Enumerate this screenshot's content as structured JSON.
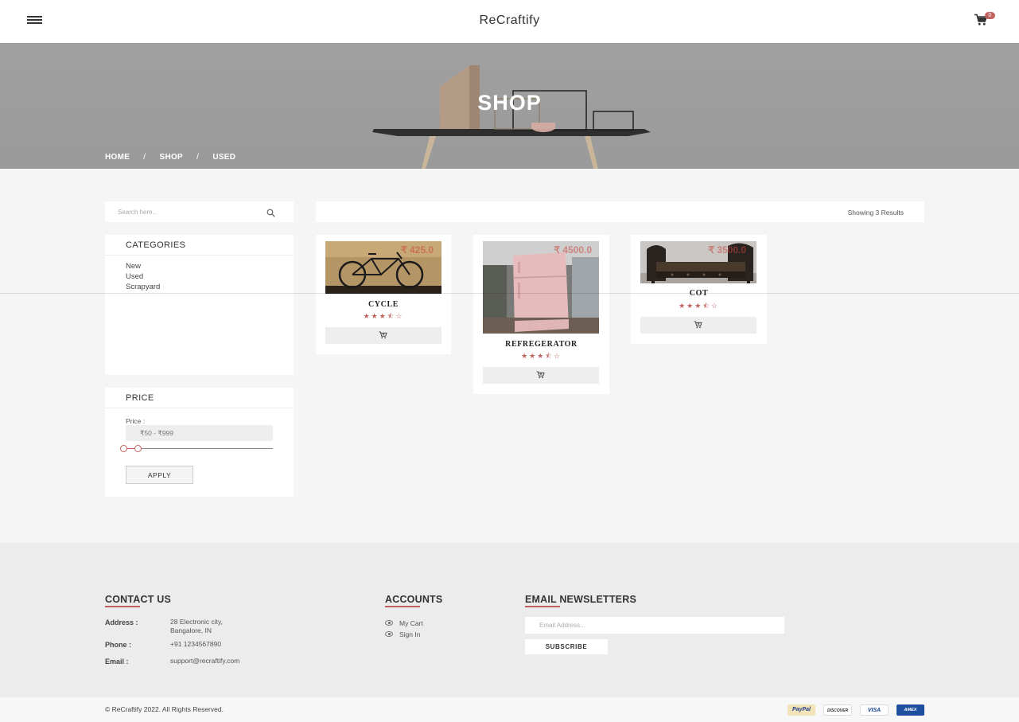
{
  "header": {
    "brand": "ReCraftify",
    "cart_count": "0"
  },
  "hero": {
    "title": "SHOP",
    "breadcrumb": [
      "HOME",
      "SHOP",
      "USED"
    ],
    "separator": "/"
  },
  "search": {
    "placeholder": "Search here..."
  },
  "categories": {
    "title": "CATEGORIES",
    "items": [
      "New",
      "Used",
      "Scrapyard"
    ]
  },
  "price_filter": {
    "title": "PRICE",
    "label": "Price :",
    "range_text": "₹50 - ₹999",
    "apply_label": "APPLY"
  },
  "results": {
    "text": "Showing 3 Results"
  },
  "products": [
    {
      "name": "CYCLE",
      "price": "₹ 425.0",
      "rating": 3.5
    },
    {
      "name": "REFREGERATOR",
      "price": "₹ 4500.0",
      "rating": 3.5
    },
    {
      "name": "COT",
      "price": "₹ 3500.0",
      "rating": 3.5
    }
  ],
  "footer": {
    "contact": {
      "title": "CONTACT US",
      "address_label": "Address :",
      "address_line1": "28 Electronic city,",
      "address_line2": "Bangalore, IN",
      "phone_label": "Phone :",
      "phone": "+91 1234567890",
      "email_label": "Email :",
      "email": "support@recraftify.com"
    },
    "accounts": {
      "title": "ACCOUNTS",
      "items": [
        "My Cart",
        "Sign In"
      ]
    },
    "newsletter": {
      "title": "EMAIL NEWSLETTERS",
      "placeholder": "Email Address...",
      "subscribe_label": "SUBSCRIBE"
    },
    "copyright": "© ReCraftify 2022. All Rights Reserved.",
    "payments": [
      "PayPal",
      "DISCOVER",
      "VISA",
      "AMEX"
    ]
  },
  "colors": {
    "accent": "#c0625e",
    "background": "#f5f5f5",
    "footer": "#ececec"
  }
}
